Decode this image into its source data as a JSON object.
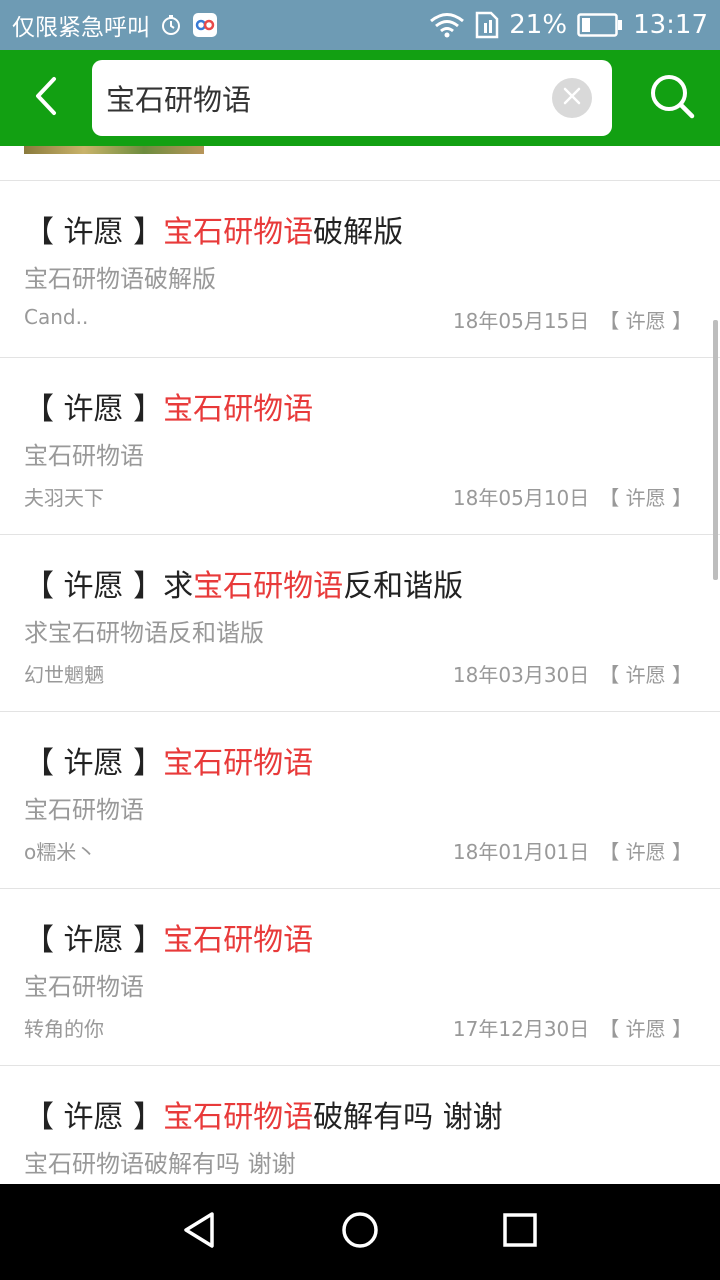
{
  "status_bar": {
    "carrier_text": "仅限紧急呼叫",
    "battery": "21%",
    "time": "13:17",
    "icons": [
      "alarm-icon",
      "app-notification-icon",
      "wifi-icon",
      "sim-icon",
      "battery-icon"
    ]
  },
  "search": {
    "query": "宝石研物语",
    "icons": {
      "back": "back-arrow-icon",
      "clear": "clear-icon",
      "search": "search-icon"
    }
  },
  "colors": {
    "status_bar": "#6e9bb4",
    "header": "#12a012",
    "highlight": "#e83a3a",
    "text_primary": "#222222",
    "text_secondary": "#999999"
  },
  "results": [
    {
      "prefix": "【 许愿 】",
      "pre": "",
      "highlight": "宝石研物语",
      "post": "破解版",
      "summary": "宝石研物语破解版",
      "author": "Cand..",
      "date": "18年05月15日",
      "category": "【 许愿 】"
    },
    {
      "prefix": "【 许愿 】",
      "pre": "",
      "highlight": "宝石研物语",
      "post": "",
      "summary": "宝石研物语",
      "author": "夫羽天下",
      "date": "18年05月10日",
      "category": "【 许愿 】"
    },
    {
      "prefix": "【 许愿 】",
      "pre": "求",
      "highlight": "宝石研物语",
      "post": "反和谐版",
      "summary": "求宝石研物语反和谐版",
      "author": "幻世魍魉",
      "date": "18年03月30日",
      "category": "【 许愿 】"
    },
    {
      "prefix": "【 许愿 】",
      "pre": "",
      "highlight": "宝石研物语",
      "post": "",
      "summary": "宝石研物语",
      "author": "o糯米丶",
      "date": "18年01月01日",
      "category": "【 许愿 】"
    },
    {
      "prefix": "【 许愿 】",
      "pre": "",
      "highlight": "宝石研物语",
      "post": "",
      "summary": "宝石研物语",
      "author": "转角的你",
      "date": "17年12月30日",
      "category": "【 许愿 】"
    },
    {
      "prefix": "【 许愿 】",
      "pre": "",
      "highlight": "宝石研物语",
      "post": "破解有吗  谢谢",
      "summary": "宝石研物语破解有吗  谢谢",
      "author": "",
      "date": "",
      "category": ""
    }
  ],
  "navigation": {
    "icons": [
      "nav-back-icon",
      "nav-home-icon",
      "nav-recents-icon"
    ]
  }
}
